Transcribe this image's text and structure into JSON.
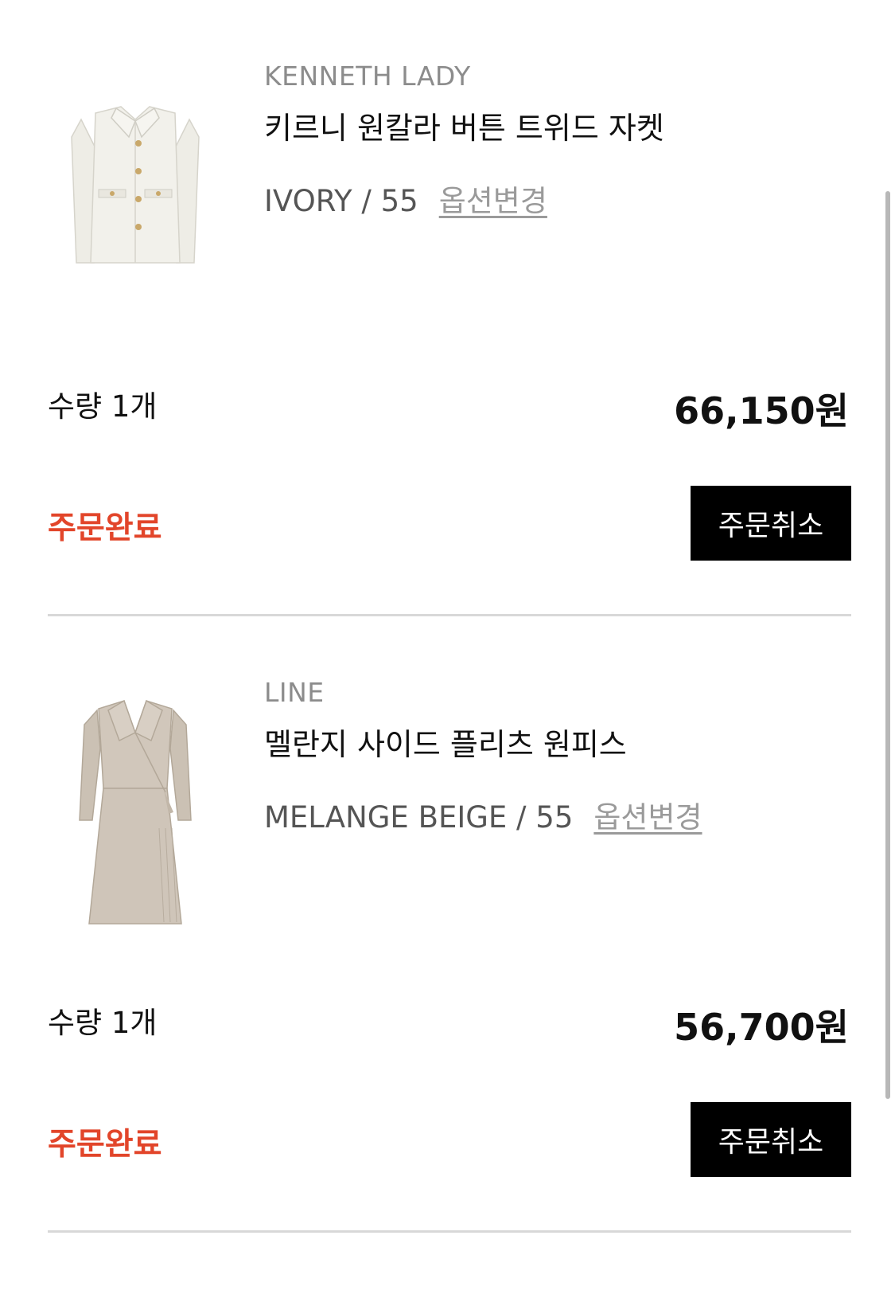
{
  "orders": [
    {
      "brand": "KENNETH LADY",
      "product_name": "키르니 원칼라 버튼 트위드 자켓",
      "option": "IVORY / 55",
      "option_change_label": "옵션변경",
      "quantity": "수량 1개",
      "price": "66,150원",
      "status": "주문완료",
      "cancel_label": "주문취소",
      "image": "ivory-tweed-jacket",
      "image_color": "#efeee8"
    },
    {
      "brand": "LINE",
      "product_name": "멜란지 사이드 플리츠 원피스",
      "option": "MELANGE BEIGE / 55",
      "option_change_label": "옵션변경",
      "quantity": "수량 1개",
      "price": "56,700원",
      "status": "주문완료",
      "cancel_label": "주문취소",
      "image": "beige-wrap-dress",
      "image_color": "#cfc5b9"
    }
  ],
  "colors": {
    "status": "#e2452a",
    "button_bg": "#000000",
    "divider": "#d8d8d8"
  }
}
